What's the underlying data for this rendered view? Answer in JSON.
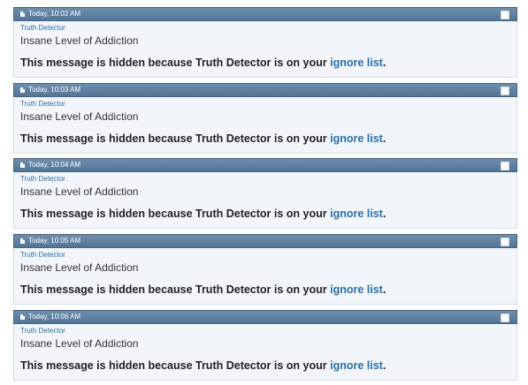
{
  "posts": [
    {
      "date": "Today, 10:02 AM",
      "username": "Truth Detector",
      "usertitle": "Insane Level of Addiction",
      "message_prefix": "This message is hidden because Truth Detector is on your ",
      "link_text": "ignore list",
      "message_suffix": "."
    },
    {
      "date": "Today, 10:03 AM",
      "username": "Truth Detector",
      "usertitle": "Insane Level of Addiction",
      "message_prefix": "This message is hidden because Truth Detector is on your ",
      "link_text": "ignore list",
      "message_suffix": "."
    },
    {
      "date": "Today, 10:04 AM",
      "username": "Truth Detector",
      "usertitle": "Insane Level of Addiction",
      "message_prefix": "This message is hidden because Truth Detector is on your ",
      "link_text": "ignore list",
      "message_suffix": "."
    },
    {
      "date": "Today, 10:05 AM",
      "username": "Truth Detector",
      "usertitle": "Insane Level of Addiction",
      "message_prefix": "This message is hidden because Truth Detector is on your ",
      "link_text": "ignore list",
      "message_suffix": "."
    },
    {
      "date": "Today, 10:06 AM",
      "username": "Truth Detector",
      "usertitle": "Insane Level of Addiction",
      "message_prefix": "This message is hidden because Truth Detector is on your ",
      "link_text": "ignore list",
      "message_suffix": "."
    }
  ],
  "colors": {
    "header_bar": "#5f80a1",
    "body_bg": "#f2f6fa",
    "link": "#2a6fa8"
  },
  "icons": {
    "post_icon": "document-icon",
    "select": "checkbox-icon"
  }
}
